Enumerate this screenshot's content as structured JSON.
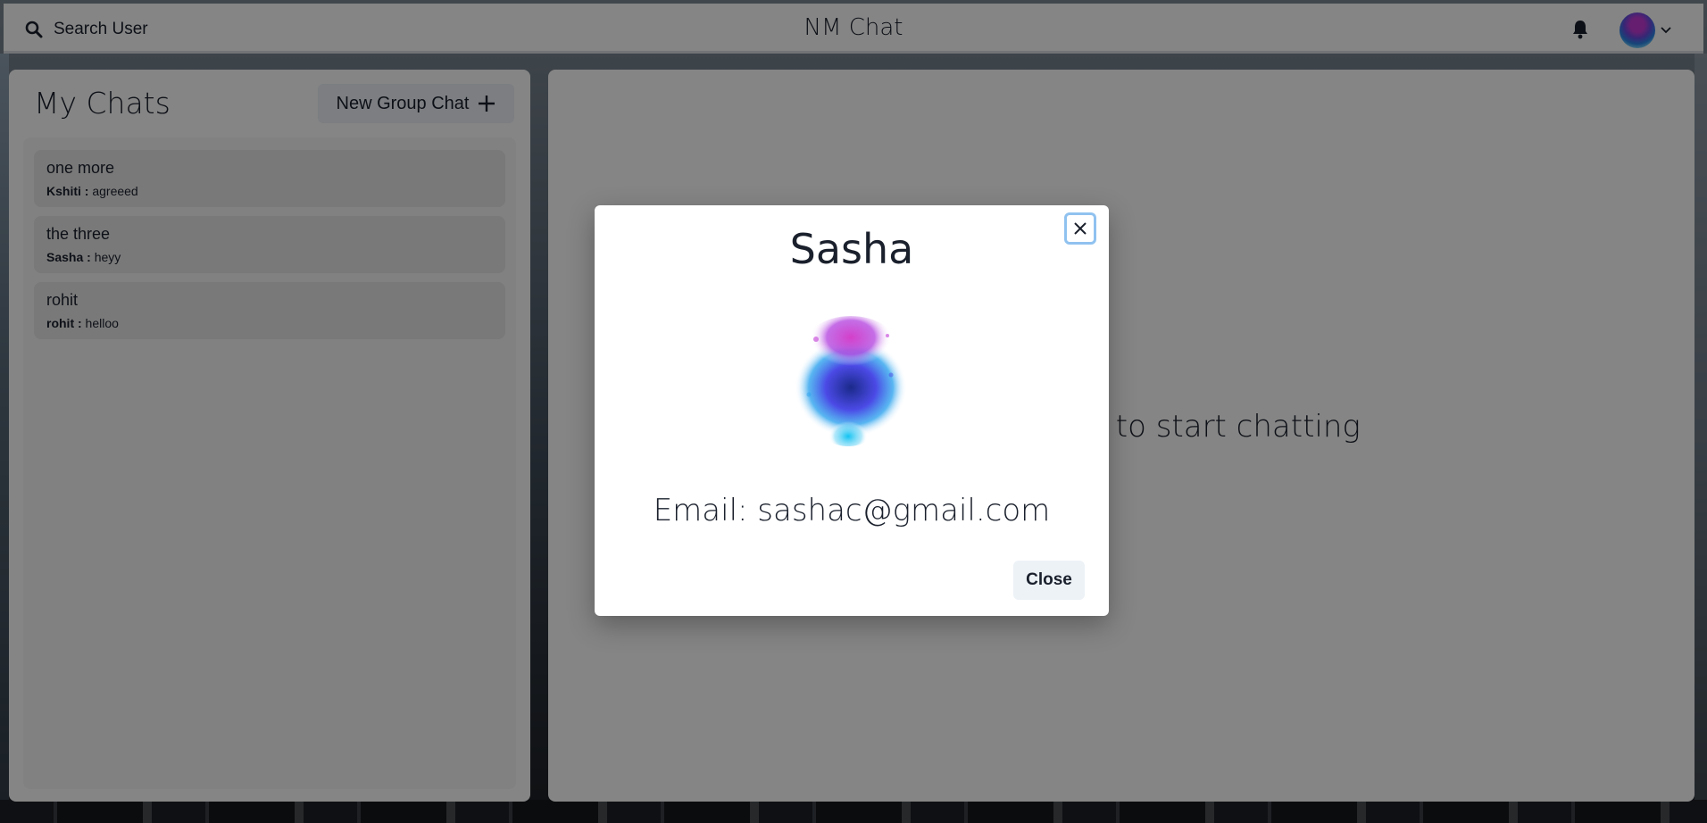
{
  "header": {
    "search_label": "Search User",
    "app_title": "NM Chat"
  },
  "sidebar": {
    "title": "My Chats",
    "new_group_label": "New Group Chat",
    "chats": [
      {
        "name": "one more",
        "sender": "Kshiti :",
        "message": "agreeed"
      },
      {
        "name": "the three",
        "sender": "Sasha :",
        "message": "heyy"
      },
      {
        "name": "rohit",
        "sender": "rohit :",
        "message": "helloo"
      }
    ]
  },
  "main": {
    "empty_message": "Click on a user to start chatting"
  },
  "modal": {
    "title": "Sasha",
    "email_text": "Email: sashac@gmail.com",
    "close_label": "Close"
  }
}
